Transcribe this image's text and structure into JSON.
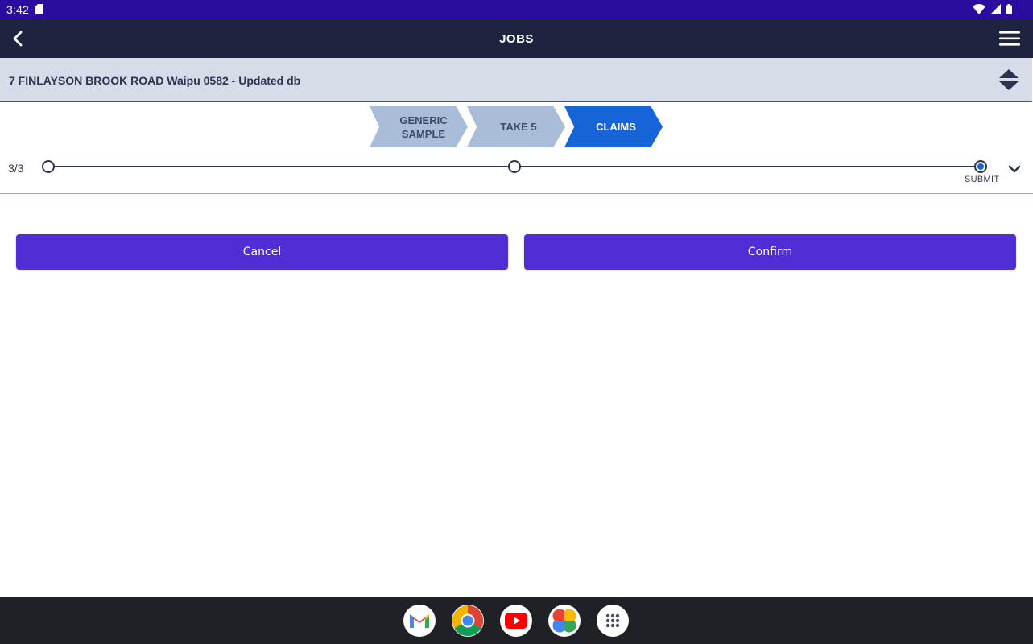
{
  "status_bar": {
    "time": "3:42",
    "icons": [
      "sd-card-icon",
      "wifi-icon",
      "signal-icon",
      "battery-icon"
    ]
  },
  "app_bar": {
    "title": "JOBS",
    "back_icon": "chevron-left-icon",
    "menu_icon": "hamburger-menu-icon"
  },
  "job": {
    "address": "7 FINLAYSON BROOK ROAD Waipu 0582 - Updated db",
    "sort_icon": "sort-up-down-icon"
  },
  "steps": [
    {
      "line1": "GENERIC",
      "line2": "SAMPLE",
      "state": "inactive"
    },
    {
      "line1": "TAKE 5",
      "line2": "",
      "state": "inactive"
    },
    {
      "line1": "CLAIMS",
      "line2": "",
      "state": "active"
    }
  ],
  "progress": {
    "count": "3/3",
    "current_step": 3,
    "total_steps": 3,
    "final_label": "SUBMIT",
    "expand_icon": "chevron-down-icon"
  },
  "actions": {
    "cancel_label": "Cancel",
    "confirm_label": "Confirm"
  },
  "colors": {
    "status_bar": "#2a0d9e",
    "app_bar": "#1e2440",
    "primary_button": "#512dd6",
    "active_step": "#1565d8",
    "inactive_step": "#a9bcd8"
  },
  "dock": {
    "apps": [
      "gmail-icon",
      "chrome-icon",
      "youtube-icon",
      "photos-icon",
      "app-drawer-icon"
    ]
  }
}
